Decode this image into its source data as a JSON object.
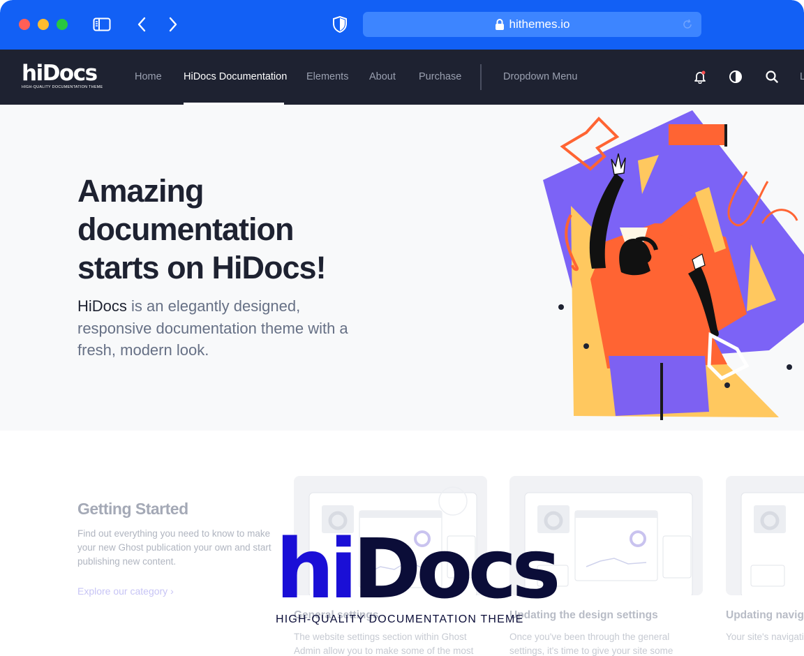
{
  "browser": {
    "url": "hithemes.io",
    "colors": {
      "chrome": "#1260f5",
      "urlbar": "#3d85ff",
      "close": "#ff5f57",
      "minimize": "#febc2e",
      "maximize": "#28c840"
    }
  },
  "site": {
    "logo": {
      "word": "hiDocs",
      "tagline": "HIGH-QUALITY DOCUMENTATION THEME"
    },
    "nav": {
      "items": [
        "Home",
        "HiDocs Documentation",
        "Elements",
        "About",
        "Purchase"
      ],
      "active": "HiDocs Documentation",
      "dropdown": "Dropdown Menu",
      "overflow": "L"
    },
    "nav_icons": [
      "bell-icon",
      "contrast-icon",
      "search-icon"
    ],
    "colors": {
      "nav_bg": "#1e2231",
      "accent": "#7c6cf6",
      "orange": "#ff6433",
      "yellow": "#ffc75e"
    }
  },
  "hero": {
    "title_lines": [
      "Amazing",
      "documentation",
      "starts on HiDocs!"
    ],
    "desc_strong": "HiDocs",
    "desc_rest": " is an elegantly designed, responsive documentation theme with a fresh, modern look."
  },
  "getting_started": {
    "title": "Getting Started",
    "desc": "Find out everything you need to know to make your new Ghost publication your own and start publishing new content.",
    "link": "Explore our category"
  },
  "cards": [
    {
      "title": "General settings",
      "desc": "The website settings section within Ghost Admin allow you to make some of the most"
    },
    {
      "title": "Updating the design settings",
      "desc": "Once you've been through the general settings, it's time to give your site some"
    },
    {
      "title": "Updating navigation",
      "desc": "Your site's navigation directly in Ghost Admin"
    }
  ],
  "overlay_logo": {
    "hi": "hi",
    "docs": "Docs",
    "tagline": "HIGH-QUALITY DOCUMENTATION THEME"
  }
}
